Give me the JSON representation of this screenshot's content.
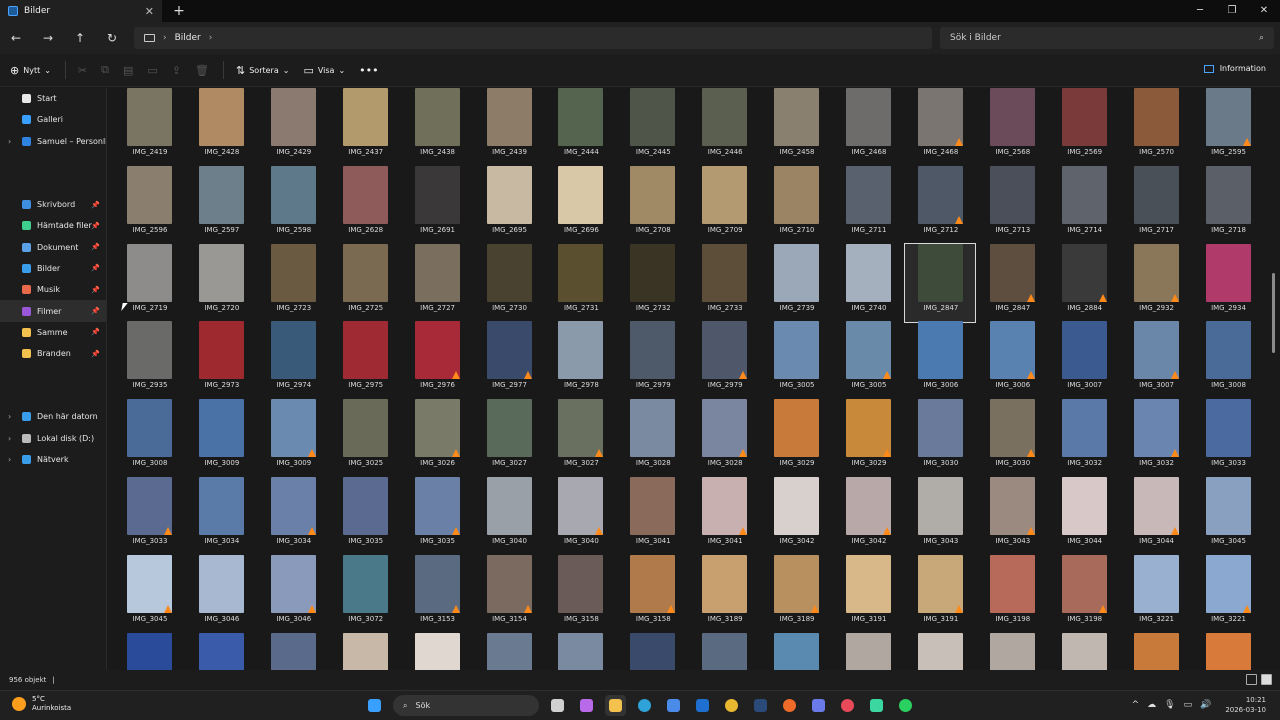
{
  "tab": {
    "title": "Bilder"
  },
  "address": {
    "crumb": "Bilder",
    "search_placeholder": "Sök i Bilder"
  },
  "toolbar": {
    "new_label": "Nytt",
    "sort_label": "Sortera",
    "view_label": "Visa",
    "info_label": "Information"
  },
  "sidebar": {
    "items": [
      {
        "label": "Start",
        "color": "#e8e8e8",
        "pinned": false,
        "expand": false
      },
      {
        "label": "Galleri",
        "color": "#3aa0ff",
        "pinned": false,
        "expand": false
      },
      {
        "label": "Samuel – Personlig",
        "color": "#2f83e0",
        "pinned": false,
        "expand": true
      },
      {
        "label": "Skrivbord",
        "color": "#3f8fe0",
        "pinned": true,
        "expand": false
      },
      {
        "label": "Hämtade filer",
        "color": "#3ecf8e",
        "pinned": true,
        "expand": false
      },
      {
        "label": "Dokument",
        "color": "#5aa0e6",
        "pinned": true,
        "expand": false
      },
      {
        "label": "Bilder",
        "color": "#3a9dea",
        "pinned": true,
        "expand": false
      },
      {
        "label": "Musik",
        "color": "#e86a4a",
        "pinned": true,
        "expand": false
      },
      {
        "label": "Filmer",
        "color": "#9a58d8",
        "pinned": true,
        "expand": false,
        "selected": true
      },
      {
        "label": "Samme",
        "color": "#f2c14e",
        "pinned": true,
        "expand": false
      },
      {
        "label": "Branden",
        "color": "#f2c14e",
        "pinned": true,
        "expand": false
      },
      {
        "label": "Den här datorn",
        "color": "#3a9dea",
        "pinned": false,
        "expand": true
      },
      {
        "label": "Lokal disk (D:)",
        "color": "#bbbbbb",
        "pinned": false,
        "expand": true
      },
      {
        "label": "Nätverk",
        "color": "#3a9dea",
        "pinned": false,
        "expand": true
      }
    ]
  },
  "files": [
    [
      "IMG_2419",
      "IMG_2428",
      "IMG_2429",
      "IMG_2437",
      "IMG_2438",
      "IMG_2439",
      "IMG_2444",
      "IMG_2445",
      "IMG_2446",
      "IMG_2458",
      "IMG_2468",
      "IMG_2468",
      "IMG_2568",
      "IMG_2569",
      "IMG_2570",
      "IMG_2595"
    ],
    [
      "IMG_2596",
      "IMG_2597",
      "IMG_2598",
      "IMG_2628",
      "IMG_2691",
      "IMG_2695",
      "IMG_2696",
      "IMG_2708",
      "IMG_2709",
      "IMG_2710",
      "IMG_2711",
      "IMG_2712",
      "IMG_2713",
      "IMG_2714",
      "IMG_2717",
      "IMG_2718"
    ],
    [
      "IMG_2719",
      "IMG_2720",
      "IMG_2723",
      "IMG_2725",
      "IMG_2727",
      "IMG_2730",
      "IMG_2731",
      "IMG_2732",
      "IMG_2733",
      "IMG_2739",
      "IMG_2740",
      "IMG_2847",
      "IMG_2847",
      "IMG_2884",
      "IMG_2932",
      "IMG_2934"
    ],
    [
      "IMG_2935",
      "IMG_2973",
      "IMG_2974",
      "IMG_2975",
      "IMG_2976",
      "IMG_2977",
      "IMG_2978",
      "IMG_2979",
      "IMG_2979",
      "IMG_3005",
      "IMG_3005",
      "IMG_3006",
      "IMG_3006",
      "IMG_3007",
      "IMG_3007",
      "IMG_3008"
    ],
    [
      "IMG_3008",
      "IMG_3009",
      "IMG_3009",
      "IMG_3025",
      "IMG_3026",
      "IMG_3027",
      "IMG_3027",
      "IMG_3028",
      "IMG_3028",
      "IMG_3029",
      "IMG_3029",
      "IMG_3030",
      "IMG_3030",
      "IMG_3032",
      "IMG_3032",
      "IMG_3033"
    ],
    [
      "IMG_3033",
      "IMG_3034",
      "IMG_3034",
      "IMG_3035",
      "IMG_3035",
      "IMG_3040",
      "IMG_3040",
      "IMG_3041",
      "IMG_3041",
      "IMG_3042",
      "IMG_3042",
      "IMG_3043",
      "IMG_3043",
      "IMG_3044",
      "IMG_3044",
      "IMG_3045"
    ],
    [
      "IMG_3045",
      "IMG_3046",
      "IMG_3046",
      "IMG_3072",
      "IMG_3153",
      "IMG_3154",
      "IMG_3158",
      "IMG_3158",
      "IMG_3189",
      "IMG_3189",
      "IMG_3191",
      "IMG_3191",
      "IMG_3198",
      "IMG_3198",
      "IMG_3221",
      "IMG_3221"
    ],
    [
      "",
      "",
      "",
      "",
      "",
      "",
      "",
      "",
      "",
      "",
      "",
      "",
      "",
      "",
      "",
      ""
    ]
  ],
  "thumb_colors": [
    [
      "#7a7463",
      "#b08a62",
      "#8a7a70",
      "#b39a6c",
      "#6f6f5a",
      "#8d7c68",
      "#55644e",
      "#4f5548",
      "#5a5f50",
      "#8a8070",
      "#6e6c6a",
      "#7a7570",
      "#6b4a5a",
      "#7a3a3a",
      "#8a5a3a",
      "#6b7a88"
    ],
    [
      "#8a7f6e",
      "#6e7f8c",
      "#5e7a8a",
      "#8e5a5a",
      "#3a3838",
      "#c8b9a3",
      "#d8c8a8",
      "#a08a66",
      "#b49a70",
      "#9a8464",
      "#59616e",
      "#4e5866",
      "#4a4f5a",
      "#5e636c",
      "#4a5058",
      "#5a5f68"
    ],
    [
      "#8e8c8a",
      "#9a9894",
      "#6a5a42",
      "#7a6a52",
      "#7a6e5e",
      "#4a4230",
      "#5a5030",
      "#3a3424",
      "#5c4e38",
      "#9aa8b8",
      "#a4b0be",
      "#3e4a3a",
      "#5e4e40",
      "#3a3a3a",
      "#8a7658",
      "#b03a6a"
    ],
    [
      "#6a6a68",
      "#9e2a30",
      "#3a5a7a",
      "#a02a34",
      "#a82a38",
      "#3a4a6a",
      "#8a9aaa",
      "#4e5a6a",
      "#4e586a",
      "#6a8ab0",
      "#6a8aaa",
      "#4a7ab0",
      "#5a82b0",
      "#3a5a90",
      "#6a86a8",
      "#4a6a98"
    ],
    [
      "#4a6a98",
      "#4a72a6",
      "#6a8ab0",
      "#6a6a58",
      "#7a7a68",
      "#5a6a5a",
      "#6a7060",
      "#7a8aa0",
      "#7a86a0",
      "#c87a3a",
      "#c88a3a",
      "#6a7a9a",
      "#7a7060",
      "#5a78a8",
      "#6a86b0",
      "#4a6aa0"
    ],
    [
      "#5a6a90",
      "#5a7aa8",
      "#6a80a8",
      "#5a6a90",
      "#6a80a6",
      "#9aa0a8",
      "#a8a8b0",
      "#8a6a5a",
      "#c8b0b0",
      "#d8d0cc",
      "#b8a8a8",
      "#b0aca8",
      "#9a8a80",
      "#d8c8c8",
      "#c8b8b8",
      "#8aa0c0"
    ],
    [
      "#b8c8dc",
      "#a8b8d0",
      "#8a9aba",
      "#4a7a8a",
      "#5a6a80",
      "#7a6a60",
      "#6a5a58",
      "#b07a4a",
      "#c8a070",
      "#b89060",
      "#d8b888",
      "#c8a878",
      "#b86a5a",
      "#a86a5a",
      "#9ab0d0",
      "#8aa8d0"
    ],
    [
      "#2a4a9a",
      "#3a5aaa",
      "#5a6a8a",
      "#c8b8a8",
      "#e0d8d0",
      "#6a7a90",
      "#7a8aa0",
      "#3a4a6a",
      "#5a6a80",
      "#5a8ab0",
      "#b0a8a0",
      "#c8c0b8",
      "#b0a8a0",
      "#c0b8b0",
      "#c87a3a",
      "#d87a3a"
    ]
  ],
  "cone_cells": [
    [
      0,
      11
    ],
    [
      0,
      15
    ],
    [
      1,
      11
    ],
    [
      2,
      12
    ],
    [
      2,
      13
    ],
    [
      2,
      14
    ],
    [
      3,
      4
    ],
    [
      3,
      5
    ],
    [
      3,
      8
    ],
    [
      3,
      10
    ],
    [
      3,
      12
    ],
    [
      3,
      14
    ],
    [
      4,
      2
    ],
    [
      4,
      4
    ],
    [
      4,
      6
    ],
    [
      4,
      8
    ],
    [
      4,
      10
    ],
    [
      4,
      12
    ],
    [
      4,
      14
    ],
    [
      5,
      0
    ],
    [
      5,
      2
    ],
    [
      5,
      4
    ],
    [
      5,
      6
    ],
    [
      5,
      8
    ],
    [
      5,
      10
    ],
    [
      5,
      12
    ],
    [
      5,
      14
    ],
    [
      6,
      0
    ],
    [
      6,
      2
    ],
    [
      6,
      4
    ],
    [
      6,
      5
    ],
    [
      6,
      7
    ],
    [
      6,
      9
    ],
    [
      6,
      11
    ],
    [
      6,
      13
    ],
    [
      6,
      15
    ]
  ],
  "selected_cell": [
    2,
    11
  ],
  "status": {
    "count": "956 objekt"
  },
  "taskbar": {
    "temp": "5°C",
    "weather": "Aurinkoista",
    "search_label": "Sök",
    "time": "10:21",
    "date": "2026-03-10"
  }
}
